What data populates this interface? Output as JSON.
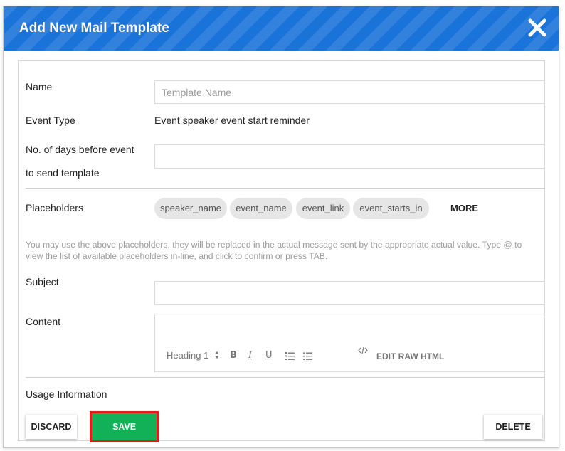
{
  "modal": {
    "title": "Add New Mail Template"
  },
  "form": {
    "name": {
      "label": "Name",
      "placeholder": "Template Name",
      "value": ""
    },
    "event_type": {
      "label": "Event Type",
      "value": "Event speaker event start reminder"
    },
    "days_before": {
      "label_line1": "No. of days before event",
      "label_line2": "to send template",
      "value": ""
    },
    "placeholders": {
      "label": "Placeholders",
      "chips": [
        "speaker_name",
        "event_name",
        "event_link",
        "event_starts_in"
      ],
      "more_label": "MORE"
    },
    "help_text": "You may use the above placeholders, they will be replaced in the actual message sent by the appropriate actual value. Type @ to view the list of available placeholders in-line, and click to confirm or press TAB.",
    "subject": {
      "label": "Subject",
      "value": ""
    },
    "content": {
      "label": "Content",
      "toolbar": {
        "heading_select": "Heading 1",
        "bold": "B",
        "italic": "I",
        "underline": "U",
        "edit_raw_html": "EDIT RAW HTML"
      }
    },
    "usage": {
      "label": "Usage Information"
    }
  },
  "buttons": {
    "discard": "DISCARD",
    "save": "SAVE",
    "delete": "DELETE"
  },
  "colors": {
    "header": "#1a73d9",
    "save": "#13b157",
    "save_highlight": "#e41b17",
    "chip": "#e6e6e6"
  },
  "icons": [
    "close-icon",
    "select-arrows-icon",
    "ordered-list-icon",
    "bullet-list-icon",
    "code-icon"
  ]
}
